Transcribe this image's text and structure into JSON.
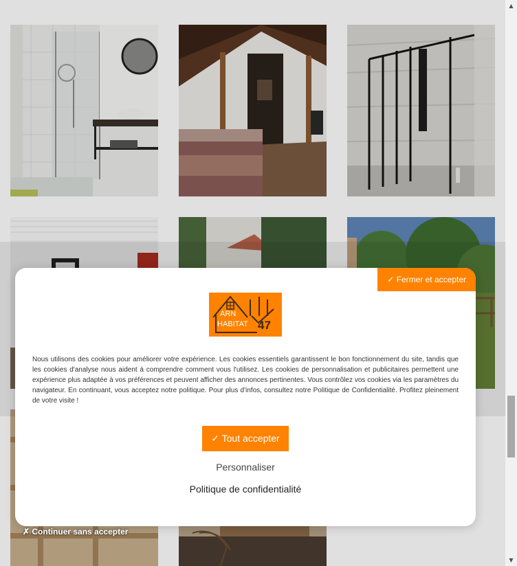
{
  "gallery": {
    "tiles": [
      {
        "icon": "bathroom-shower-photo"
      },
      {
        "icon": "attic-bedroom-photo"
      },
      {
        "icon": "black-frame-shower-photo"
      },
      {
        "icon": "room-ceiling-photo"
      },
      {
        "icon": "stone-house-photo"
      },
      {
        "icon": "garden-trees-photo"
      },
      {
        "icon": "wooden-shelves-photo"
      },
      {
        "icon": "terrace-chair-photo"
      }
    ]
  },
  "cookie_modal": {
    "close_accept_label": "✓ Fermer et accepter",
    "logo": {
      "line1": "ARN",
      "line2": "HABITAT",
      "number": "47"
    },
    "notice": "Nous utilisons des cookies pour améliorer votre expérience. Les cookies essentiels garantissent le bon fonctionnement du site, tandis que les cookies d'analyse nous aident à comprendre comment vous l'utilisez. Les cookies de personnalisation et publicitaires permettent une expérience plus adaptée à vos préférences et peuvent afficher des annonces pertinentes. Vous contrôlez vos cookies via les paramètres du navigateur. En continuant, vous acceptez notre politique. Pour plus d'infos, consultez notre Politique de Confidentialité. Profitez pleinement de votre visite !",
    "accept_all_label": "✓ Tout accepter",
    "customize_label": "Personnaliser",
    "privacy_label": "Politique de confidentialité",
    "continue_label": "✗ Continuer sans accepter"
  },
  "colors": {
    "accent": "#ff8200"
  }
}
